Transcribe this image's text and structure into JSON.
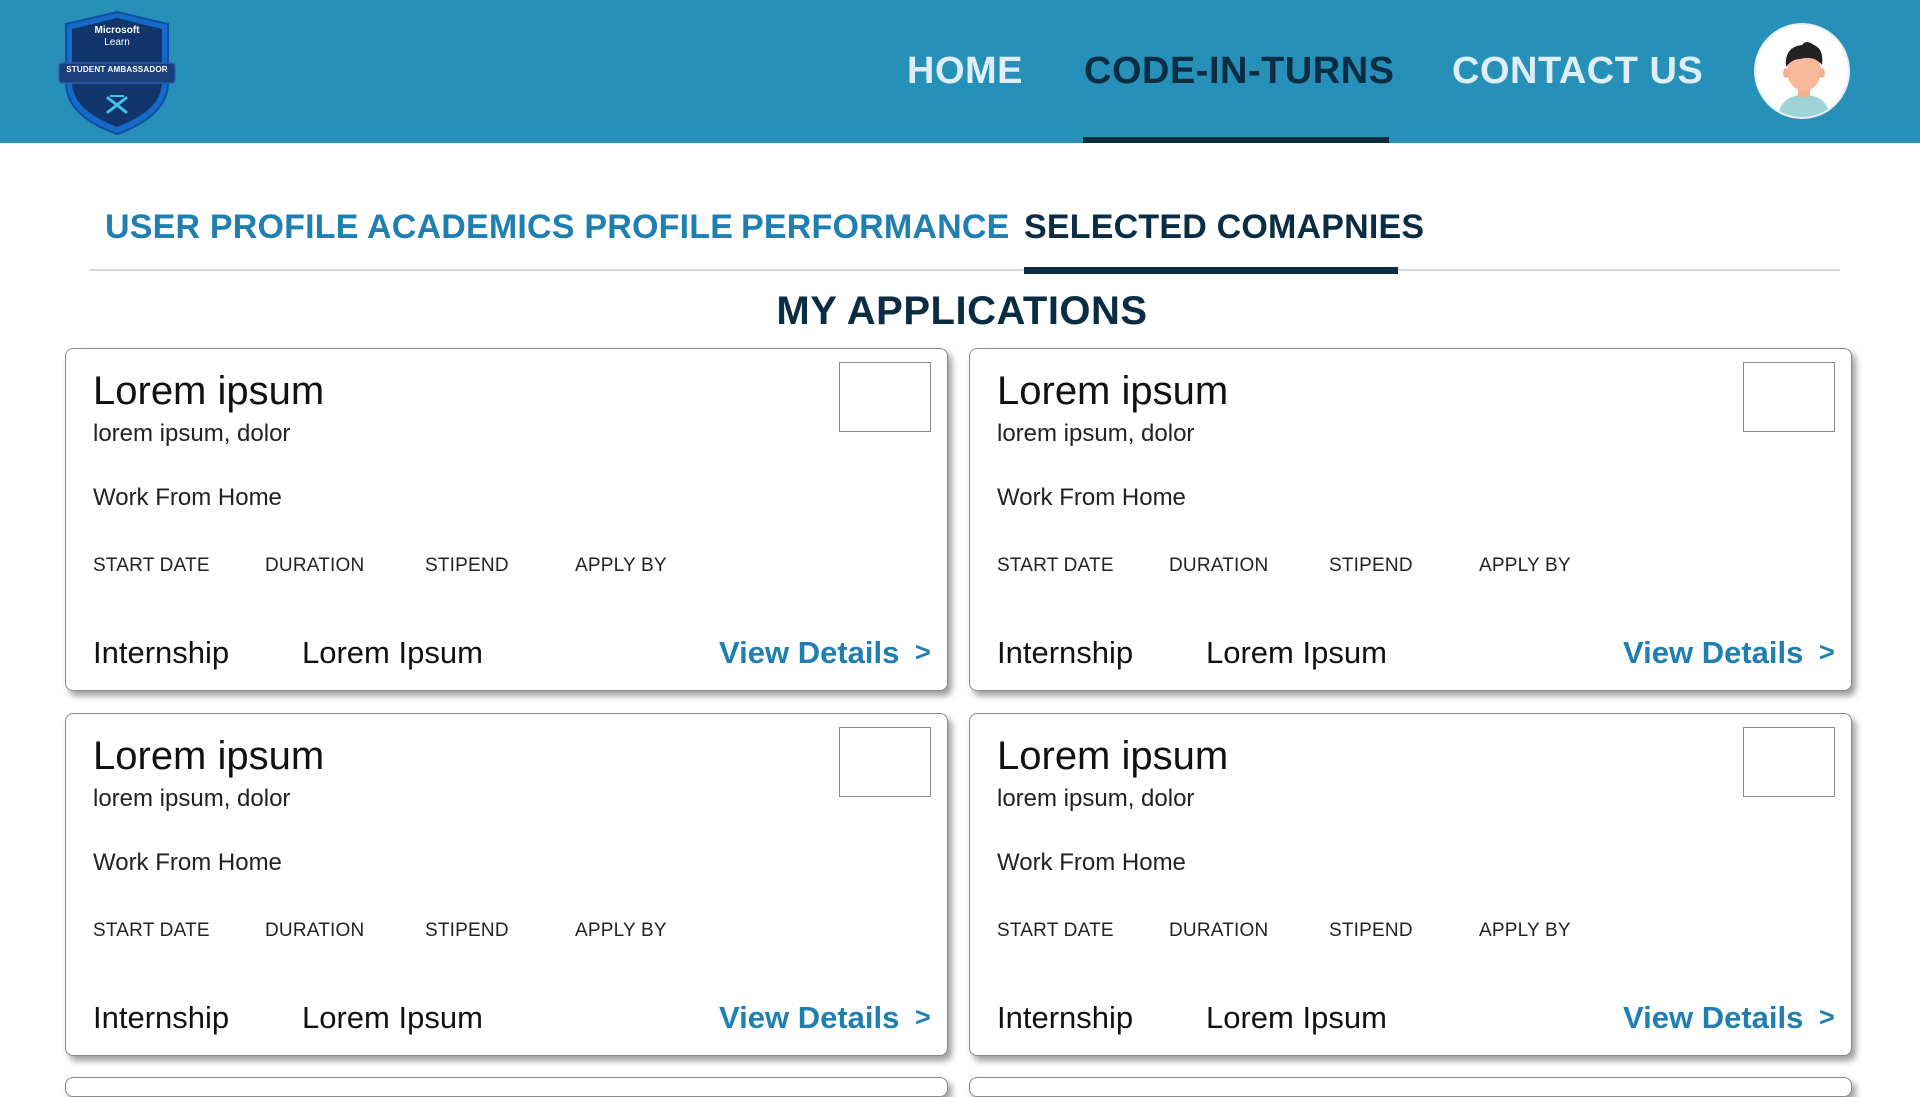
{
  "header": {
    "logo": {
      "line1": "Microsoft",
      "line2": "Learn",
      "line3": "STUDENT AMBASSADOR",
      "icon": "ambassador-badge-icon"
    },
    "nav": [
      {
        "label": "HOME",
        "active": false
      },
      {
        "label": "CODE-IN-TURNS",
        "active": true
      },
      {
        "label": "CONTACT US",
        "active": false
      }
    ],
    "avatar_icon": "user-avatar-icon",
    "background_color": "#2690b8",
    "active_color": "#0b2d44"
  },
  "tabs": [
    {
      "label": "USER PROFILE",
      "active": false
    },
    {
      "label": "ACADEMICS PROFILE",
      "active": false
    },
    {
      "label": "PERFORMANCE",
      "active": false
    },
    {
      "label": "SELECTED COMAPNIES",
      "active": true
    }
  ],
  "section_title": "MY APPLICATIONS",
  "cards": [
    {
      "title": "Lorem ipsum",
      "subtitle": "lorem ipsum, dolor",
      "mode": "Work From Home",
      "meta": [
        "START DATE",
        "DURATION",
        "STIPEND",
        "APPLY BY"
      ],
      "type": "Internship",
      "company": "Lorem Ipsum",
      "view_label": "View Details",
      "arrow": ">"
    },
    {
      "title": "Lorem ipsum",
      "subtitle": "lorem ipsum, dolor",
      "mode": "Work From Home",
      "meta": [
        "START DATE",
        "DURATION",
        "STIPEND",
        "APPLY BY"
      ],
      "type": "Internship",
      "company": "Lorem Ipsum",
      "view_label": "View Details",
      "arrow": ">"
    },
    {
      "title": "Lorem ipsum",
      "subtitle": "lorem ipsum, dolor",
      "mode": "Work From Home",
      "meta": [
        "START DATE",
        "DURATION",
        "STIPEND",
        "APPLY BY"
      ],
      "type": "Internship",
      "company": "Lorem Ipsum",
      "view_label": "View Details",
      "arrow": ">"
    },
    {
      "title": "Lorem ipsum",
      "subtitle": "lorem ipsum, dolor",
      "mode": "Work From Home",
      "meta": [
        "START DATE",
        "DURATION",
        "STIPEND",
        "APPLY BY"
      ],
      "type": "Internship",
      "company": "Lorem Ipsum",
      "view_label": "View Details",
      "arrow": ">"
    }
  ],
  "colors": {
    "accent": "#1f7fb0",
    "dark": "#0b2d44",
    "card_border": "#8a8a8a"
  }
}
